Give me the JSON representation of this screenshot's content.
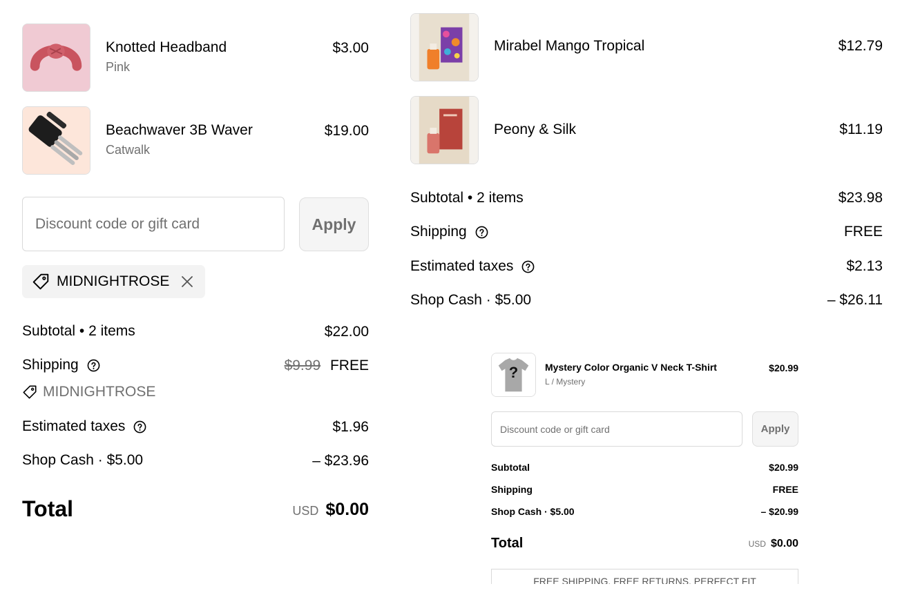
{
  "left_cart": {
    "items": [
      {
        "name": "Knotted Headband",
        "variant": "Pink",
        "price": "$3.00"
      },
      {
        "name": "Beachwaver 3B Waver",
        "variant": "Catwalk",
        "price": "$19.00"
      }
    ],
    "discount": {
      "placeholder": "Discount code or gift card",
      "apply_label": "Apply"
    },
    "applied_code": "MIDNIGHTROSE",
    "summary": {
      "subtotal_label": "Subtotal • 2 items",
      "subtotal_value": "$22.00",
      "shipping_label": "Shipping",
      "shipping_original": "$9.99",
      "shipping_value": "FREE",
      "shipping_code": "MIDNIGHTROSE",
      "taxes_label": "Estimated taxes",
      "taxes_value": "$1.96",
      "shopcash_label": "Shop Cash · $5.00",
      "shopcash_value": "– $23.96",
      "total_label": "Total",
      "total_currency": "USD",
      "total_value": "$0.00"
    }
  },
  "right_cart": {
    "items": [
      {
        "name": "Mirabel Mango Tropical",
        "price": "$12.79"
      },
      {
        "name": "Peony & Silk",
        "price": "$11.19"
      }
    ],
    "summary": {
      "subtotal_label": "Subtotal • 2 items",
      "subtotal_value": "$23.98",
      "shipping_label": "Shipping",
      "shipping_value": "FREE",
      "taxes_label": "Estimated taxes",
      "taxes_value": "$2.13",
      "shopcash_label": "Shop Cash · $5.00",
      "shopcash_value": "– $26.11"
    }
  },
  "small_cart": {
    "item": {
      "name": "Mystery Color Organic V Neck T-Shirt",
      "variant": "L / Mystery",
      "price": "$20.99",
      "thumb_mark": "?"
    },
    "discount": {
      "placeholder": "Discount code or gift card",
      "apply_label": "Apply"
    },
    "summary": {
      "subtotal_label": "Subtotal",
      "subtotal_value": "$20.99",
      "shipping_label": "Shipping",
      "shipping_value": "FREE",
      "shopcash_label": "Shop Cash · $5.00",
      "shopcash_value": "– $20.99",
      "total_label": "Total",
      "total_currency": "USD",
      "total_value": "$0.00"
    },
    "banner": "FREE SHIPPING, FREE RETURNS, PERFECT FIT"
  },
  "icons": {
    "tag": "tag-icon",
    "close": "close-icon",
    "help": "help-circle-icon"
  },
  "colors": {
    "muted_text": "#707070",
    "chip_bg": "#f3f3f3",
    "button_bg": "#f5f5f5",
    "border": "#d9d9d9"
  }
}
